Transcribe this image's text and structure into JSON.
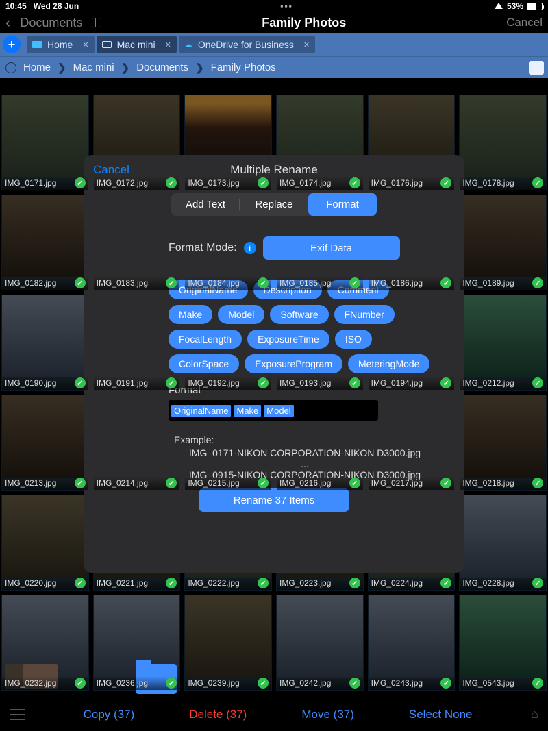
{
  "status": {
    "time": "10:45",
    "date": "Wed 28 Jun",
    "battery": "53%"
  },
  "titlebar": {
    "back": "Documents",
    "title": "Family Photos",
    "cancel": "Cancel"
  },
  "tabs": [
    {
      "label": "Home"
    },
    {
      "label": "Mac mini"
    },
    {
      "label": "OneDrive for Business"
    }
  ],
  "breadcrumb": [
    "Home",
    "Mac mini",
    "Documents",
    "Family Photos"
  ],
  "grid": [
    {
      "name": "IMG_0171.jpg"
    },
    {
      "name": "IMG_0172.jpg"
    },
    {
      "name": "IMG_0173.jpg"
    },
    {
      "name": "IMG_0174.jpg"
    },
    {
      "name": "IMG_0176.jpg"
    },
    {
      "name": "IMG_0178.jpg"
    },
    {
      "name": "IMG_0182.jpg"
    },
    {
      "name": "IMG_0183.jpg"
    },
    {
      "name": "IMG_0184.jpg"
    },
    {
      "name": "IMG_0185.jpg"
    },
    {
      "name": "IMG_0186.jpg"
    },
    {
      "name": "IMG_0189.jpg"
    },
    {
      "name": "IMG_0190.jpg"
    },
    {
      "name": "IMG_0191.jpg"
    },
    {
      "name": "IMG_0192.jpg"
    },
    {
      "name": "IMG_0193.jpg"
    },
    {
      "name": "IMG_0194.jpg"
    },
    {
      "name": "IMG_0212.jpg"
    },
    {
      "name": "IMG_0213.jpg"
    },
    {
      "name": "IMG_0214.jpg"
    },
    {
      "name": "IMG_0215.jpg"
    },
    {
      "name": "IMG_0216.jpg"
    },
    {
      "name": "IMG_0217.jpg"
    },
    {
      "name": "IMG_0218.jpg"
    },
    {
      "name": "IMG_0220.jpg"
    },
    {
      "name": "IMG_0221.jpg"
    },
    {
      "name": "IMG_0222.jpg"
    },
    {
      "name": "IMG_0223.jpg"
    },
    {
      "name": "IMG_0224.jpg"
    },
    {
      "name": "IMG_0228.jpg"
    },
    {
      "name": "IMG_0232.jpg"
    },
    {
      "name": "IMG_0236.jpg"
    },
    {
      "name": "IMG_0239.jpg"
    },
    {
      "name": "IMG_0242.jpg"
    },
    {
      "name": "IMG_0243.jpg"
    },
    {
      "name": "IMG_0543.jpg"
    }
  ],
  "modal": {
    "cancel": "Cancel",
    "title": "Multiple Rename",
    "segments": [
      "Add Text",
      "Replace",
      "Format"
    ],
    "mode_label": "Format Mode:",
    "mode_value": "Exif Data",
    "chips": [
      "OriginalName",
      "Description",
      "Comment",
      "Make",
      "Model",
      "Software",
      "FNumber",
      "FocalLength",
      "ExposureTime",
      "ISO",
      "ColorSpace",
      "ExposureProgram",
      "MeteringMode"
    ],
    "format_label": "Format",
    "format_tokens": [
      "OriginalName",
      "Make",
      "Model"
    ],
    "example_label": "Example:",
    "example_1": "IMG_0171-NIKON CORPORATION-NIKON D3000.jpg",
    "ellipsis": "...",
    "example_2": "IMG_0915-NIKON CORPORATION-NIKON D3000.jpg",
    "rename_button": "Rename 37 Items"
  },
  "footer": {
    "copy": "Copy (37)",
    "delete": "Delete (37)",
    "move": "Move (37)",
    "select_none": "Select None"
  }
}
